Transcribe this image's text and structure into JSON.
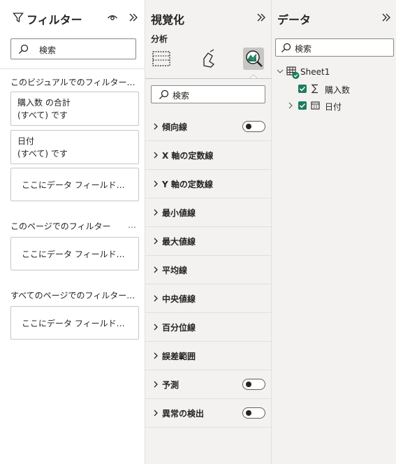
{
  "filters": {
    "title": "フィルター",
    "search_placeholder": "検索",
    "sections": {
      "visual": {
        "title": "このビジュアルでのフィルター…"
      },
      "page": {
        "title": "このページでのフィルター",
        "more": "…"
      },
      "all": {
        "title": "すべてのページでのフィルター…"
      }
    },
    "cards": [
      {
        "field": "購入数 の合計",
        "condition": "(すべて) です"
      },
      {
        "field": "日付",
        "condition": "(すべて) です"
      }
    ],
    "drop_text": "ここにデータ フィールド…"
  },
  "viz": {
    "title": "視覚化",
    "subtitle": "分析",
    "search_placeholder": "検索",
    "items": [
      {
        "label": "傾向線",
        "toggle": true
      },
      {
        "label": "X 軸の定数線"
      },
      {
        "label": "Y 軸の定数線"
      },
      {
        "label": "最小値線"
      },
      {
        "label": "最大値線"
      },
      {
        "label": "平均線"
      },
      {
        "label": "中央値線"
      },
      {
        "label": "百分位線"
      },
      {
        "label": "誤差範囲"
      },
      {
        "label": "予測",
        "toggle": true
      },
      {
        "label": "異常の検出",
        "toggle": true
      }
    ]
  },
  "data": {
    "title": "データ",
    "search_placeholder": "検索",
    "table": {
      "name": "Sheet1"
    },
    "fields": [
      {
        "name": "購入数",
        "checked": true
      },
      {
        "name": "日付",
        "checked": true
      }
    ]
  },
  "colors": {
    "accent": "#1d7c5f",
    "pane_bg": "#f3f2f1",
    "border": "#e1dfdd"
  }
}
